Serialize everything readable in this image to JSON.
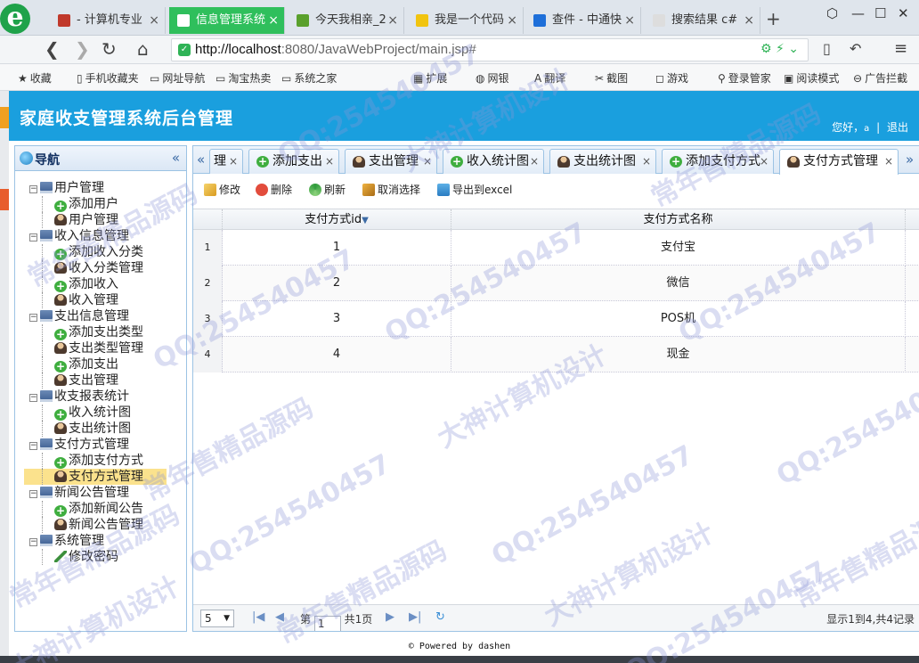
{
  "browser": {
    "tabs": [
      {
        "label": "- 计算机专业",
        "fav": "#c0392b"
      },
      {
        "label": "信息管理系统",
        "fav": "#ffffff",
        "active": true
      },
      {
        "label": "今天我相亲_2",
        "fav": "#5aa02c"
      },
      {
        "label": "我是一个代码",
        "fav": "#f1c40f"
      },
      {
        "label": "查件 - 中通快",
        "fav": "#1e6fd9"
      },
      {
        "label": "搜索结果 c#",
        "fav": "#dddddd"
      }
    ],
    "new_tab": "+",
    "url_host": "http://localhost",
    "url_rest": ":8080/JavaWebProject/main.jsp#",
    "bookmarks": [
      "收藏",
      "手机收藏夹",
      "网址导航",
      "淘宝热卖",
      "系统之家",
      "扩展",
      "网银",
      "翻译",
      "截图",
      "游戏",
      "登录管家",
      "阅读模式",
      "广告拦截"
    ]
  },
  "header": {
    "title": "家庭收支管理系统后台管理",
    "greeting": "您好，",
    "username": "a",
    "separator": "|",
    "logout": "退出"
  },
  "nav": {
    "title": "导航",
    "groups": [
      {
        "label": "用户管理",
        "items": [
          {
            "label": "添加用户",
            "icon": "plus"
          },
          {
            "label": "用户管理",
            "icon": "user"
          }
        ]
      },
      {
        "label": "收入信息管理",
        "items": [
          {
            "label": "添加收入分类",
            "icon": "plus"
          },
          {
            "label": "收入分类管理",
            "icon": "user"
          },
          {
            "label": "添加收入",
            "icon": "plus"
          },
          {
            "label": "收入管理",
            "icon": "user"
          }
        ]
      },
      {
        "label": "支出信息管理",
        "items": [
          {
            "label": "添加支出类型",
            "icon": "plus"
          },
          {
            "label": "支出类型管理",
            "icon": "user"
          },
          {
            "label": "添加支出",
            "icon": "plus"
          },
          {
            "label": "支出管理",
            "icon": "user"
          }
        ]
      },
      {
        "label": "收支报表统计",
        "items": [
          {
            "label": "收入统计图",
            "icon": "plus"
          },
          {
            "label": "支出统计图",
            "icon": "user"
          }
        ]
      },
      {
        "label": "支付方式管理",
        "items": [
          {
            "label": "添加支付方式",
            "icon": "plus"
          },
          {
            "label": "支付方式管理",
            "icon": "user",
            "selected": true
          }
        ]
      },
      {
        "label": "新闻公告管理",
        "items": [
          {
            "label": "添加新闻公告",
            "icon": "plus"
          },
          {
            "label": "新闻公告管理",
            "icon": "user"
          }
        ]
      },
      {
        "label": "系统管理",
        "items": [
          {
            "label": "修改密码",
            "icon": "pen"
          }
        ]
      }
    ]
  },
  "tabs": [
    {
      "label": "理",
      "icon": "none"
    },
    {
      "label": "添加支出",
      "icon": "plus"
    },
    {
      "label": "支出管理",
      "icon": "user"
    },
    {
      "label": "收入统计图",
      "icon": "plus"
    },
    {
      "label": "支出统计图",
      "icon": "user"
    },
    {
      "label": "添加支付方式",
      "icon": "plus"
    },
    {
      "label": "支付方式管理",
      "icon": "user",
      "active": true
    }
  ],
  "toolbar": {
    "edit": "修改",
    "delete": "删除",
    "refresh": "刷新",
    "unselect": "取消选择",
    "export": "导出到excel"
  },
  "grid": {
    "columns": [
      "支付方式id",
      "支付方式名称"
    ],
    "rows": [
      {
        "num": "1",
        "id": "1",
        "name": "支付宝"
      },
      {
        "num": "2",
        "id": "2",
        "name": "微信"
      },
      {
        "num": "3",
        "id": "3",
        "name": "POS机"
      },
      {
        "num": "4",
        "id": "4",
        "name": "现金"
      }
    ]
  },
  "pager": {
    "page_size": "5",
    "page_prefix": "第",
    "page_value": "1",
    "page_suffix": "共1页",
    "summary": "显示1到4,共4记录"
  },
  "footer": "© Powered by dashen",
  "watermarks": [
    "QQ:254540457",
    "大神计算机设计",
    "常年售精品源码"
  ]
}
